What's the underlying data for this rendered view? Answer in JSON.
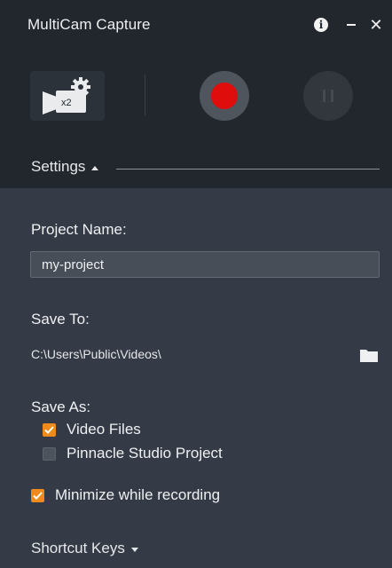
{
  "window": {
    "title": "MultiCam Capture"
  },
  "toolbar": {
    "camera_count": "x2"
  },
  "settings": {
    "toggle_label": "Settings",
    "expanded": true,
    "project_name_label": "Project Name:",
    "project_name_value": "my-project",
    "save_to_label": "Save To:",
    "save_to_path": "C:\\Users\\Public\\Videos\\",
    "save_as_label": "Save As:",
    "save_as_options": [
      {
        "label": "Video Files",
        "checked": true
      },
      {
        "label": "Pinnacle Studio Project",
        "checked": false
      }
    ],
    "minimize_label": "Minimize while recording",
    "minimize_checked": true
  },
  "shortcut_keys": {
    "toggle_label": "Shortcut Keys",
    "expanded": false
  },
  "colors": {
    "accent": "#f08a1c",
    "record": "#e00d0d",
    "title_bar": "#22272d",
    "panel": "#353b46"
  },
  "icons": [
    "info-icon",
    "minimize-icon",
    "close-icon",
    "camera-settings-icon",
    "record-icon",
    "pause-icon",
    "folder-icon",
    "checkmark-icon",
    "caret-up-icon",
    "caret-down-icon"
  ]
}
